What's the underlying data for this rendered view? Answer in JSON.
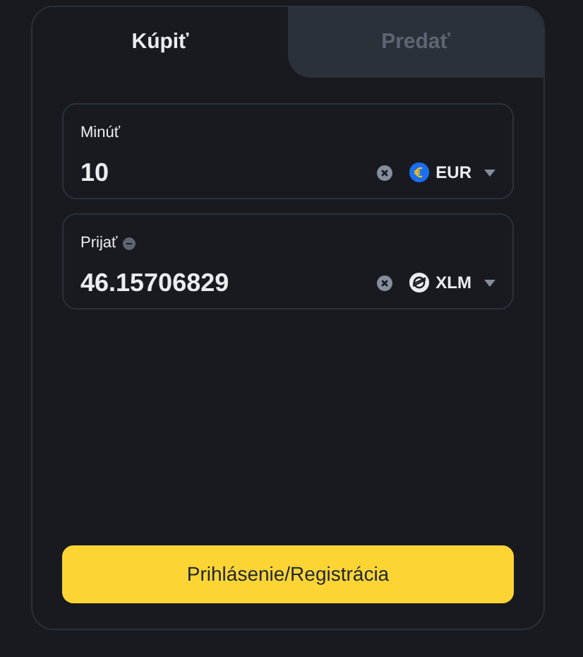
{
  "tabs": [
    {
      "label": "Kúpiť",
      "selected": true
    },
    {
      "label": "Predať",
      "selected": false
    }
  ],
  "fields": [
    {
      "label": "Minúť",
      "info": false,
      "value": "10",
      "currency": "EUR",
      "kind": "euro"
    },
    {
      "label": "Prijať",
      "info": true,
      "value": "46.15706829",
      "currency": "XLM",
      "kind": "stellar"
    }
  ],
  "submit": "Prihlásenie/Registrácia"
}
